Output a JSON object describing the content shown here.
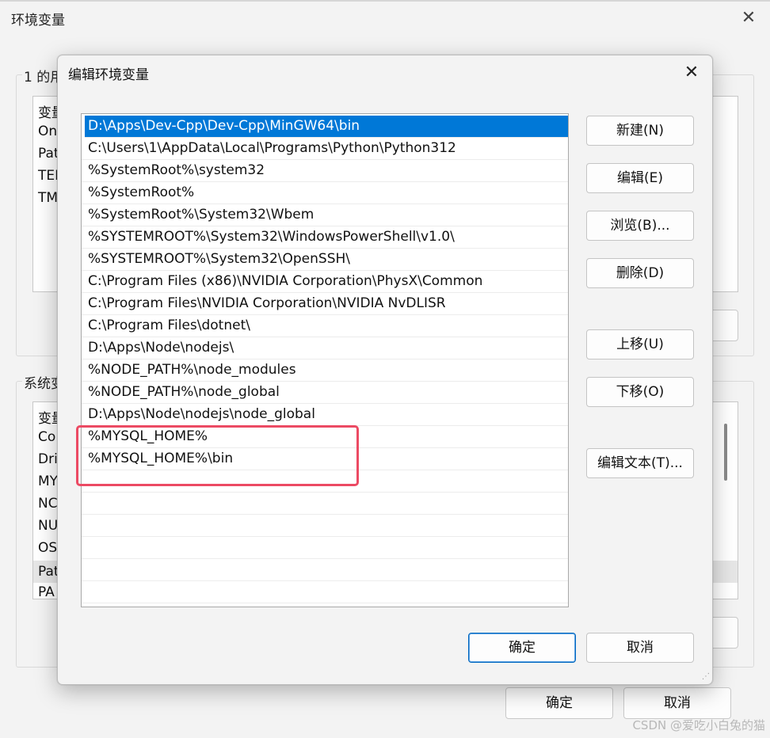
{
  "background_window": {
    "title": "环境变量",
    "close_glyph": "✕",
    "user_group_legend": "1 的用",
    "user_list": {
      "header": "变量",
      "rows": [
        "On",
        "Pat",
        "TEI",
        "TM"
      ]
    },
    "system_group_legend": "系统变",
    "system_list": {
      "header": "变量",
      "rows": [
        "Co",
        "Dri",
        "MY",
        "NC",
        "NU",
        "OS",
        "Pat",
        "PA"
      ]
    },
    "ok_label": "确定",
    "cancel_label": "取消"
  },
  "dialog": {
    "title": "编辑环境变量",
    "close_glyph": "✕",
    "selected_index": 0,
    "paths": [
      "D:\\Apps\\Dev-Cpp\\Dev-Cpp\\MinGW64\\bin",
      "C:\\Users\\1\\AppData\\Local\\Programs\\Python\\Python312",
      "%SystemRoot%\\system32",
      "%SystemRoot%",
      "%SystemRoot%\\System32\\Wbem",
      "%SYSTEMROOT%\\System32\\WindowsPowerShell\\v1.0\\",
      "%SYSTEMROOT%\\System32\\OpenSSH\\",
      "C:\\Program Files (x86)\\NVIDIA Corporation\\PhysX\\Common",
      "C:\\Program Files\\NVIDIA Corporation\\NVIDIA NvDLISR",
      "C:\\Program Files\\dotnet\\",
      "D:\\Apps\\Node\\nodejs\\",
      "%NODE_PATH%\\node_modules",
      "%NODE_PATH%\\node_global",
      "D:\\Apps\\Node\\nodejs\\node_global",
      "%MYSQL_HOME%",
      "%MYSQL_HOME%\\bin"
    ],
    "buttons": {
      "new": "新建(N)",
      "edit": "编辑(E)",
      "browse": "浏览(B)...",
      "delete": "删除(D)",
      "move_up": "上移(U)",
      "move_down": "下移(O)",
      "edit_text": "编辑文本(T)...",
      "ok": "确定",
      "cancel": "取消"
    }
  },
  "watermark": "CSDN @爱吃小白兔的猫",
  "colors": {
    "selection": "#0078d7",
    "highlight_box": "#ec4a63"
  }
}
